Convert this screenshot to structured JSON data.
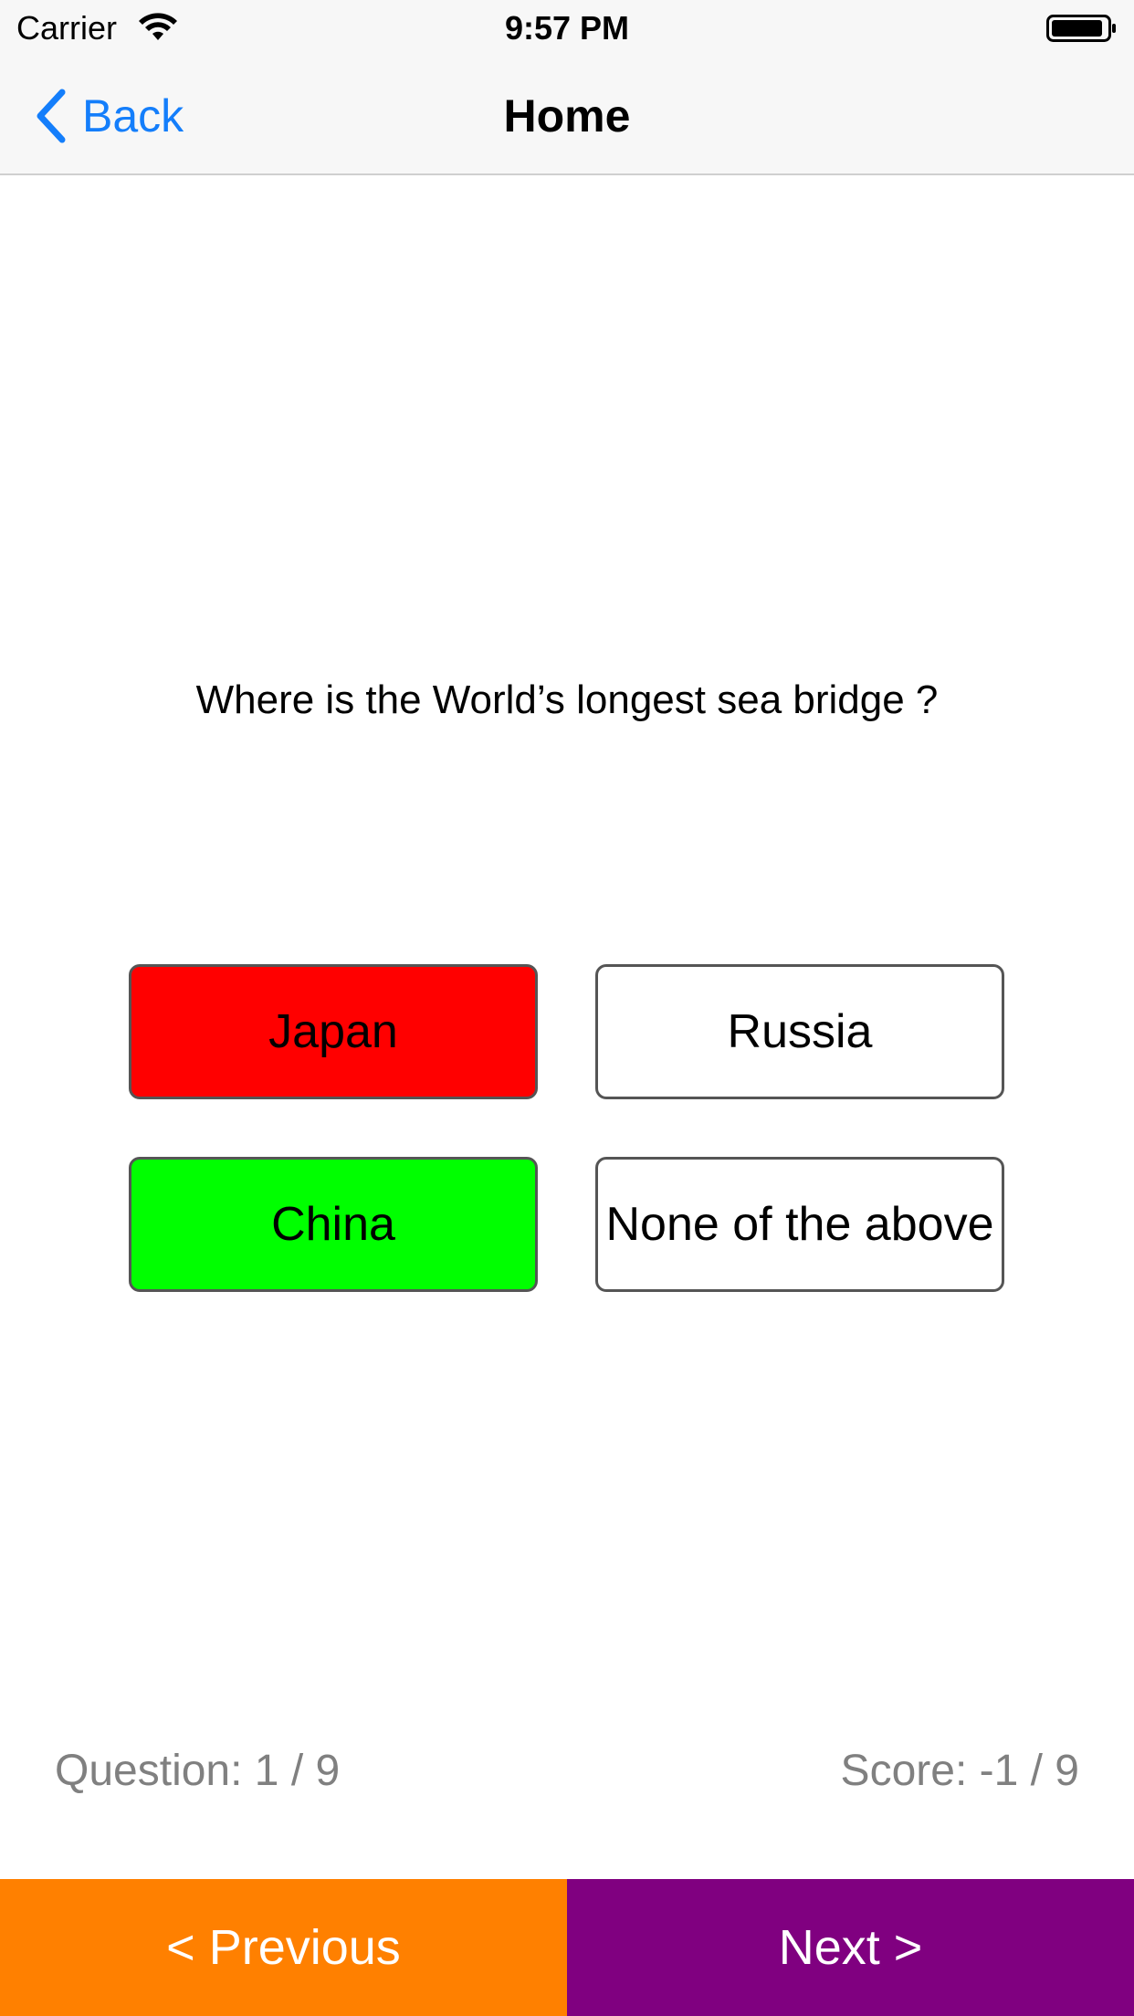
{
  "status_bar": {
    "carrier": "Carrier",
    "time": "9:57 PM"
  },
  "nav": {
    "back_label": "Back",
    "title": "Home"
  },
  "quiz": {
    "question": "Where is the World’s longest sea bridge ?",
    "answers": [
      {
        "label": "Japan",
        "color": "#ff0000"
      },
      {
        "label": "Russia",
        "color": "#ffffff"
      },
      {
        "label": "China",
        "color": "#00ff00"
      },
      {
        "label": "None of the above",
        "color": "#ffffff"
      }
    ],
    "question_count": "Question: 1 / 9",
    "score": "Score: -1 / 9"
  },
  "footer": {
    "previous_label": "< Previous",
    "previous_color": "#ff8000",
    "next_label": "Next >",
    "next_color": "#800080"
  },
  "colors": {
    "accent": "#147efb"
  }
}
